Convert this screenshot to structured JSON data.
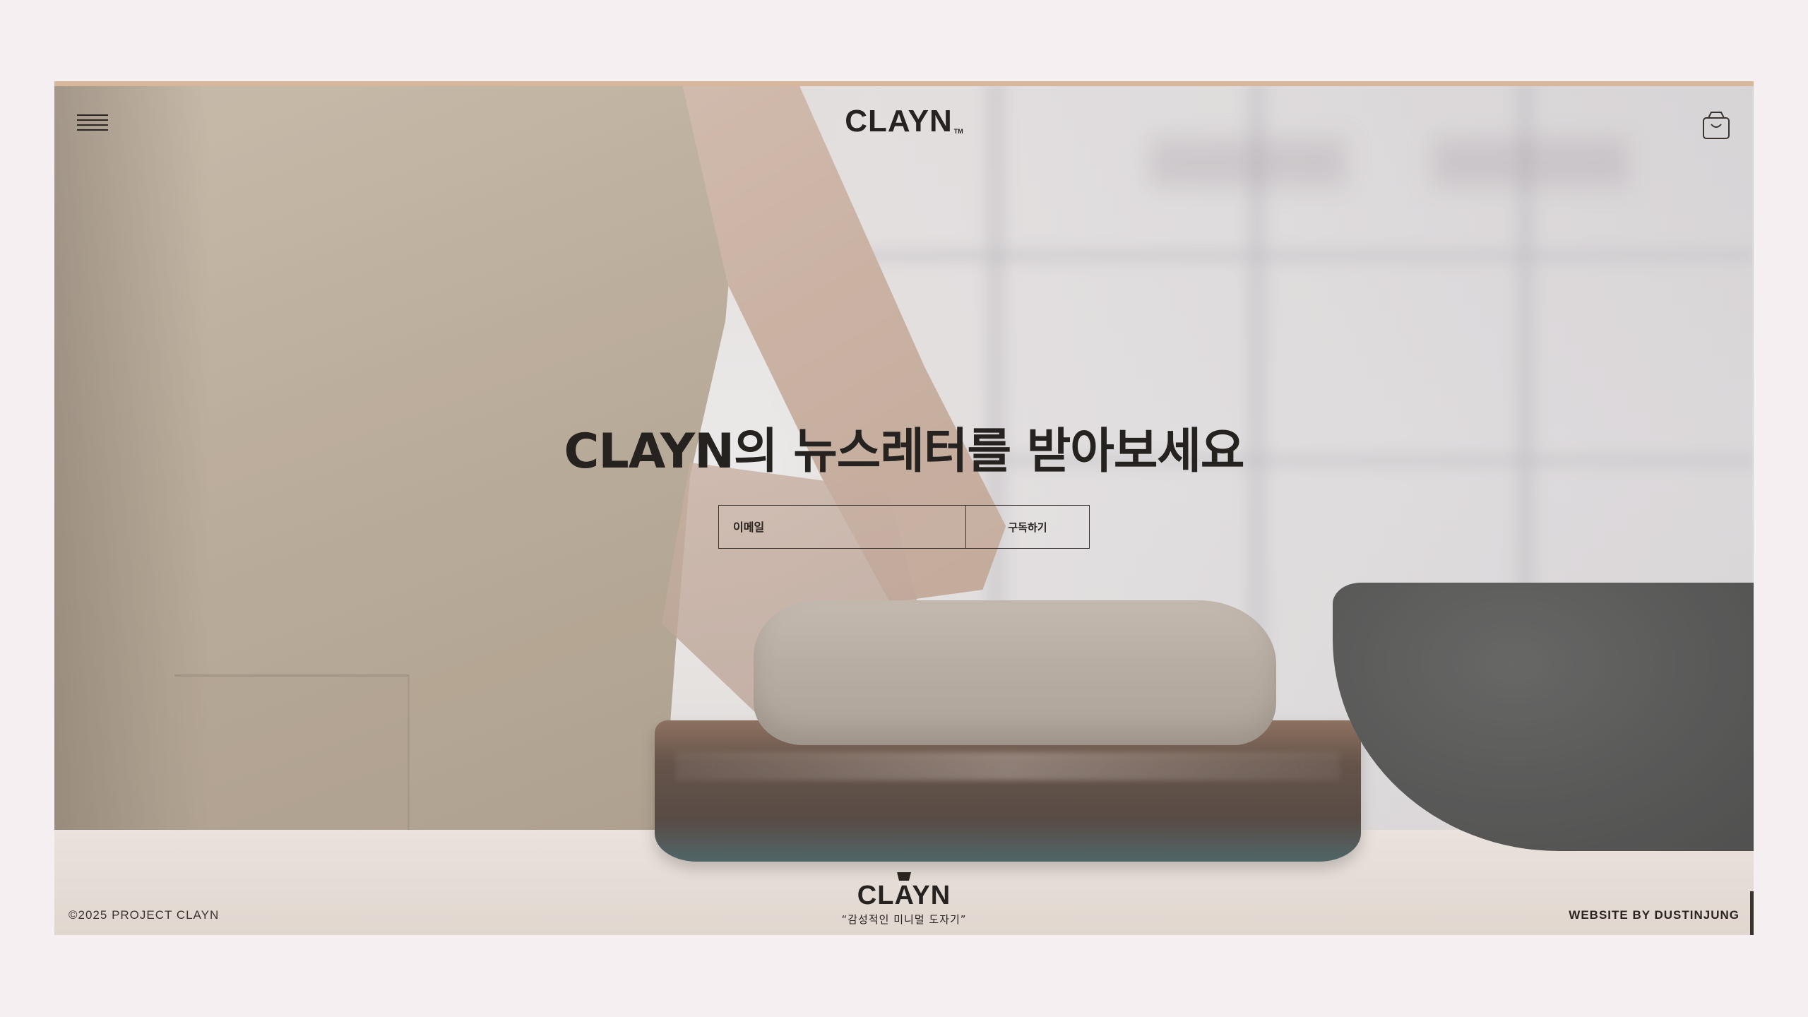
{
  "header": {
    "logo_text": "CLAYN",
    "logo_tm": "TM"
  },
  "hero": {
    "headline": "CLAYN의 뉴스레터를 받아보세요",
    "email_placeholder": "이메일",
    "subscribe_label": "구독하기"
  },
  "footer": {
    "copyright": "©2025 PROJECT CLAYN",
    "logo_text": "CLAYN",
    "tagline": "“감성적인 미니멀 도자기”",
    "credit": "WEBSITE BY DUSTINJUNG"
  },
  "colors": {
    "page_bg": "#f6eff2",
    "accent_strip": "#d6b79b",
    "text_dark": "#262220"
  },
  "icons": {
    "menu": "hamburger-menu-icon",
    "cart": "shopping-bag-icon"
  }
}
